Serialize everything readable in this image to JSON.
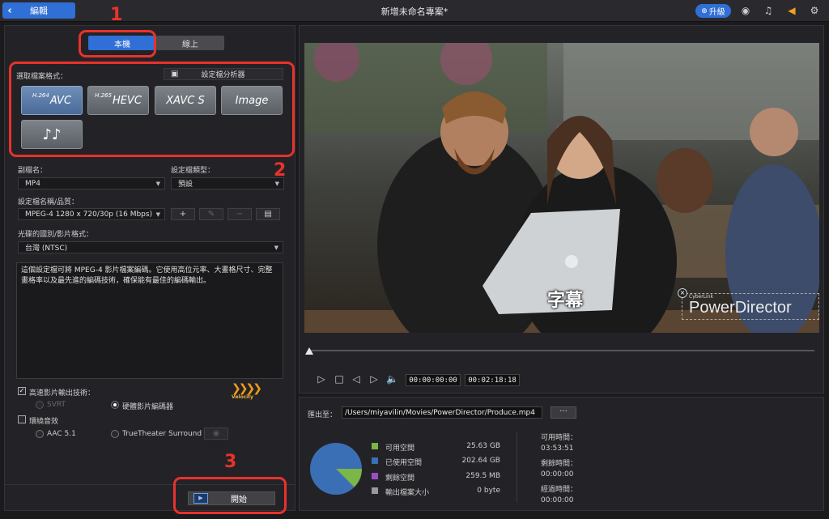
{
  "header": {
    "back_label": "編輯",
    "project_title": "新增未命名專案*",
    "upgrade_label": "升級"
  },
  "tabs": [
    {
      "label": "本機",
      "active": true
    },
    {
      "label": "線上",
      "active": false
    }
  ],
  "format": {
    "label": "選取檔案格式：",
    "analyzer_label": "設定檔分析器",
    "buttons": [
      {
        "prefix": "H.264",
        "label": "AVC",
        "selected": true
      },
      {
        "prefix": "H.265",
        "label": "HEVC",
        "selected": false
      },
      {
        "prefix": "",
        "label": "XAVC S",
        "selected": false
      },
      {
        "prefix": "",
        "label": "Image",
        "selected": false
      },
      {
        "prefix": "",
        "label": "♪♪",
        "selected": false
      }
    ]
  },
  "settings": {
    "ext_label": "副檔名：",
    "ext_value": "MP4",
    "profile_type_label": "設定檔類型：",
    "profile_type_value": "預設",
    "profile_name_label": "設定檔名稱/品質：",
    "profile_name_value": "MPEG-4 1280 x 720/30p (16 Mbps)",
    "region_label": "光碟的國別/影片格式：",
    "region_value": "台灣 (NTSC)",
    "description": "這個設定檔可將 MPEG-4 影片檔案編碼。它使用高位元率、大畫格尺寸、完整畫格率以及最先進的編碼技術，確保能有最佳的編碼輸出。"
  },
  "options": {
    "fast_render_label": "高速影片輸出技術：",
    "svrt_label": "SVRT",
    "hw_encoder_label": "硬體影片編碼器",
    "surround_label": "環繞音效",
    "aac_label": "AAC 5.1",
    "truetheater_label": "TrueTheater Surround",
    "velocity_label": "Velocity"
  },
  "start_label": "開始",
  "annotations": [
    "1",
    "2",
    "3"
  ],
  "preview": {
    "subtitle": "字幕",
    "watermark_brand": "CyberLink",
    "watermark_text": "PowerDirector",
    "current_time": "00:00:00:00",
    "total_time": "00:02:18:18"
  },
  "output": {
    "path_label": "匯出至：",
    "path_value": "/Users/miyavilin/Movies/PowerDirector/Produce.mp4",
    "browse_label": "···",
    "legend": [
      {
        "label": "可用空間",
        "value": "25.63 GB",
        "color": "#7ab648"
      },
      {
        "label": "已使用空間",
        "value": "202.64 GB",
        "color": "#3a6fb5"
      },
      {
        "label": "剩餘空間",
        "value": "259.5 MB",
        "color": "#9a4fc0"
      },
      {
        "label": "輸出檔案大小",
        "value": "0 byte",
        "color": "#9a9a9a"
      }
    ],
    "available_time_label": "可用時間：",
    "available_time_value": "03:53:51",
    "remaining_time_label": "剩餘時間：",
    "remaining_time_value": "00:00:00",
    "elapsed_time_label": "經過時間：",
    "elapsed_time_value": "00:00:00"
  },
  "colors": {
    "accent": "#2f6fd6",
    "annotation": "#e8322b"
  }
}
